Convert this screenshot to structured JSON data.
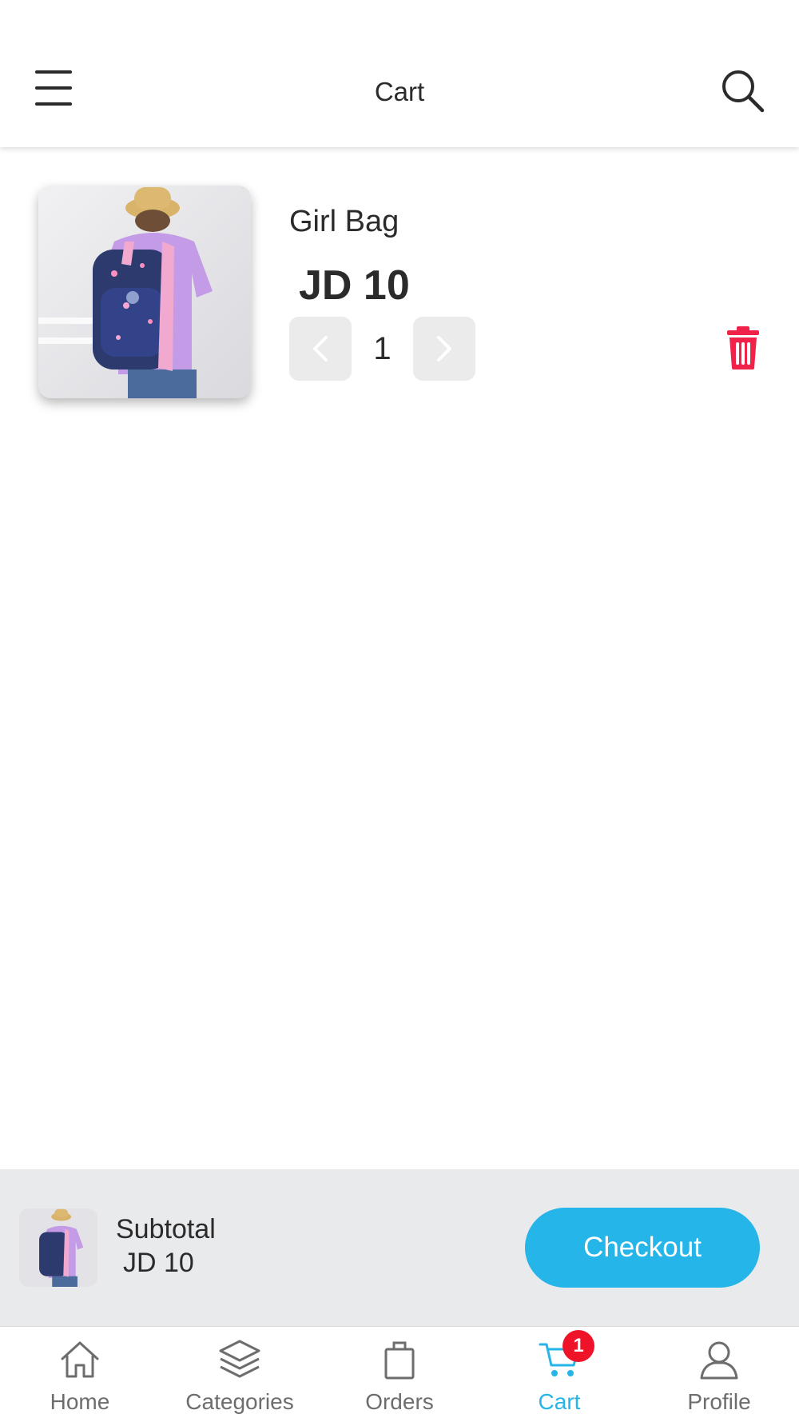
{
  "header": {
    "title": "Cart",
    "menu_icon": "hamburger-menu-icon",
    "search_icon": "search-icon"
  },
  "cart": {
    "items": [
      {
        "name": "Girl Bag",
        "price": "JD 10",
        "quantity": "1",
        "image": "girl-bag-product-photo"
      }
    ]
  },
  "summary": {
    "subtotal_label": "Subtotal",
    "subtotal_value": "JD 10",
    "checkout_label": "Checkout"
  },
  "nav": {
    "items": [
      {
        "label": "Home",
        "icon": "home-icon"
      },
      {
        "label": "Categories",
        "icon": "layers-icon"
      },
      {
        "label": "Orders",
        "icon": "shopping-bag-icon"
      },
      {
        "label": "Cart",
        "icon": "cart-icon",
        "badge": "1",
        "active": true
      },
      {
        "label": "Profile",
        "icon": "user-icon"
      }
    ]
  },
  "colors": {
    "accent": "#26b5e8",
    "delete": "#f0224a",
    "badge": "#ef1329",
    "summary_bg": "#e9eaec"
  }
}
